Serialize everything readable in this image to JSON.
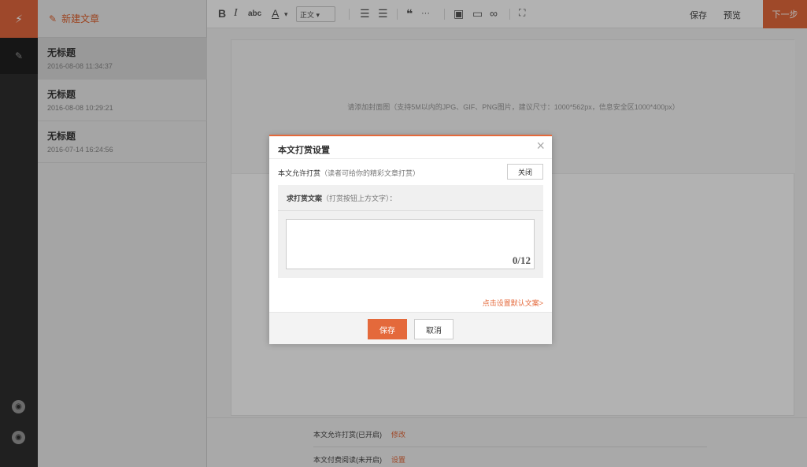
{
  "rail": {
    "top_icon": "bolt-icon",
    "write_icon": "pen-icon",
    "bottom_icon_1": "circle-icon",
    "bottom_icon_2": "circle-icon"
  },
  "sidebar": {
    "new_article_label": "新建文章",
    "articles": [
      {
        "title": "无标题",
        "date": "2016-08-08 11:34:37"
      },
      {
        "title": "无标题",
        "date": "2016-08-08 10:29:21"
      },
      {
        "title": "无标题",
        "date": "2016-07-14 16:24:56"
      }
    ]
  },
  "toolbar": {
    "bold": "B",
    "italic": "I",
    "strike": "abc",
    "font_color": "A",
    "paragraph_style": "正文",
    "quote": "❝",
    "divider": "···",
    "save_label": "保存",
    "preview_label": "预览",
    "next_label": "下一步"
  },
  "editor": {
    "cover_hint": "请添加封面图（支持5M以内的JPG、GIF、PNG图片，建议尺寸：1000*562px，信息安全区1000*400px）"
  },
  "footer": {
    "reward_status": "本文允许打赏(已开启)",
    "reward_action": "修改",
    "paid_status": "本文付费阅读(未开启)",
    "paid_action": "设置"
  },
  "modal": {
    "title": "本文打赏设置",
    "close_icon": "close-icon",
    "allow_label": "本文允许打赏",
    "allow_sub": "（读者可给你的精彩文章打赏）",
    "off_button": "关闭",
    "copy_label": "求打赏文案",
    "copy_sub": "（打赏按钮上方文字）：",
    "textarea_value": "",
    "counter": "0/12",
    "default_link": "点击设置默认文案>",
    "save_button": "保存",
    "cancel_button": "取消"
  },
  "colors": {
    "accent": "#e4693b",
    "rail": "#2e2e2e",
    "overlay": "rgba(0,0,0,0.30)"
  }
}
